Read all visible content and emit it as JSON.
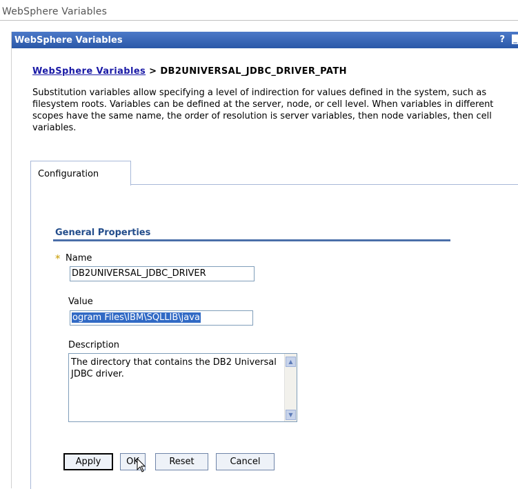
{
  "page": {
    "title": "WebSphere Variables"
  },
  "portlet": {
    "title": "WebSphere Variables",
    "help": "?",
    "minimize": "_"
  },
  "breadcrumb": {
    "link": "WebSphere Variables",
    "separator": " > ",
    "current": "DB2UNIVERSAL_JDBC_DRIVER_PATH"
  },
  "description": "Substitution variables allow specifying a level of indirection for values defined in the system, such as filesystem roots. Variables can be defined at the server, node, or cell level. When variables in different scopes have the same name, the order of resolution is server variables, then node variables, then cell variables.",
  "tabs": [
    {
      "label": "Configuration",
      "active": true
    }
  ],
  "general_properties": {
    "title": "General Properties",
    "required_marker": "*",
    "name": {
      "label": "Name",
      "value": "DB2UNIVERSAL_JDBC_DRIVER"
    },
    "value": {
      "label": "Value",
      "value": "ogram Files\\IBM\\SQLLIB\\java"
    },
    "description": {
      "label": "Description",
      "value": "The directory that contains the DB2 Universal JDBC driver."
    }
  },
  "buttons": {
    "apply": "Apply",
    "ok": "OK",
    "reset": "Reset",
    "cancel": "Cancel"
  },
  "colors": {
    "title_bar": "#2a58a8",
    "link": "#1a1aa6",
    "section_rule": "#4a6ea9",
    "selection": "#316ac5",
    "required": "#c89c00"
  }
}
